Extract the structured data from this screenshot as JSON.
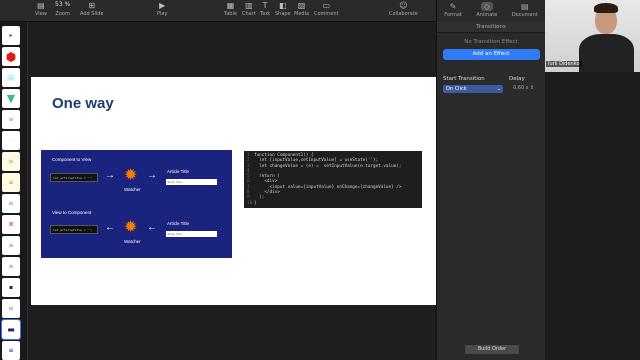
{
  "toolbar": {
    "view": "View",
    "zoom": "53 %",
    "zoom_label": "Zoom",
    "add_slide": "Add Slide",
    "play": "Play",
    "table": "Table",
    "chart": "Chart",
    "text": "Text",
    "shape": "Shape",
    "media": "Media",
    "comment": "Comment",
    "collaborate": "Collaborate"
  },
  "panel": {
    "format": "Format",
    "animate": "Animate",
    "document": "Document",
    "subtitle": "Transitions",
    "no_transition": "No Transition Effect",
    "add_effect": "Add an Effect",
    "start_label": "Start Transition",
    "start_value": "On Click",
    "delay_label": "Delay",
    "delay_value": "0,60 s",
    "build_order": "Build Order"
  },
  "webcam": {
    "name": "Iurii Didenko"
  },
  "slide": {
    "title": "One way",
    "diagram": {
      "top_label": "Component to View",
      "bottom_label": "View to Component",
      "code_text": "let articleTitle = '';",
      "watcher": "Watcher",
      "article_title": "Article Title",
      "input_placeholder": "Enter Title..."
    },
    "code_lines": [
      "function Component1() {",
      "  let [inputValue,setInputValue] = useState('');",
      "  let changeValue = (e) =  setInputValue(e.target.value);",
      "",
      "  return (",
      "    <div>",
      "      <input value={inputValue} onChange={changeValue} />",
      "    </div>",
      "  );",
      "}"
    ]
  },
  "colors": {
    "accent": "#2f7cf6",
    "title": "#1a3d6e",
    "diagram_bg": "#1a237e",
    "gear": "#f57c00"
  }
}
